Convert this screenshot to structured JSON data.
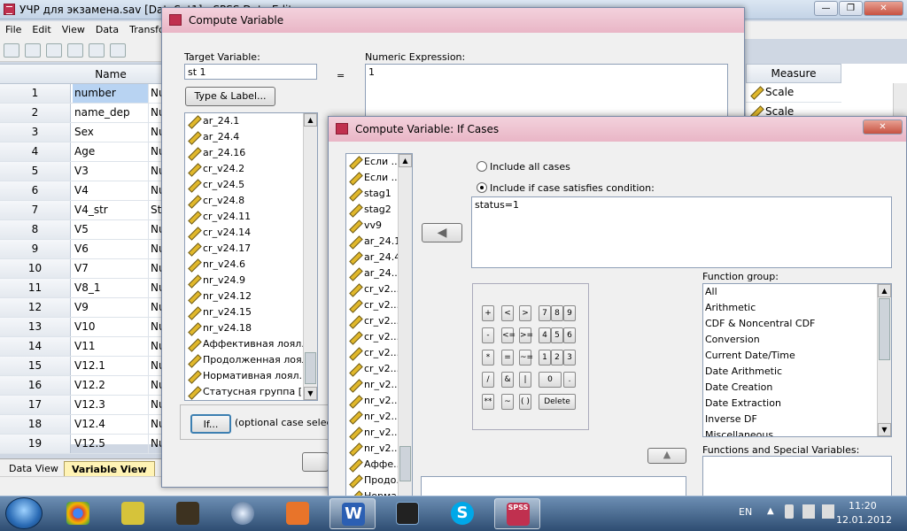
{
  "main_window": {
    "title": "УЧР для экзамена.sav [DataSet1] - SPSS Data Editor",
    "menu": [
      "File",
      "Edit",
      "View",
      "Data",
      "Transform"
    ],
    "grid": {
      "name_header": "Name",
      "rows": [
        {
          "n": "1",
          "name": "number",
          "type": "Nu"
        },
        {
          "n": "2",
          "name": "name_dep",
          "type": "Nu"
        },
        {
          "n": "3",
          "name": "Sex",
          "type": "Nu"
        },
        {
          "n": "4",
          "name": "Age",
          "type": "Nu"
        },
        {
          "n": "5",
          "name": "V3",
          "type": "Nu"
        },
        {
          "n": "6",
          "name": "V4",
          "type": "Nu"
        },
        {
          "n": "7",
          "name": "V4_str",
          "type": "St"
        },
        {
          "n": "8",
          "name": "V5",
          "type": "Nu"
        },
        {
          "n": "9",
          "name": "V6",
          "type": "Nu"
        },
        {
          "n": "10",
          "name": "V7",
          "type": "Nu"
        },
        {
          "n": "11",
          "name": "V8_1",
          "type": "Nu"
        },
        {
          "n": "12",
          "name": "V9",
          "type": "Nu"
        },
        {
          "n": "13",
          "name": "V10",
          "type": "Nu"
        },
        {
          "n": "14",
          "name": "V11",
          "type": "Nu"
        },
        {
          "n": "15",
          "name": "V12.1",
          "type": "Nu"
        },
        {
          "n": "16",
          "name": "V12.2",
          "type": "Nu"
        },
        {
          "n": "17",
          "name": "V12.3",
          "type": "Nu"
        },
        {
          "n": "18",
          "name": "V12.4",
          "type": "Nu"
        },
        {
          "n": "19",
          "name": "V12.5",
          "type": "Nu"
        }
      ]
    },
    "tabs": {
      "data_view": "Data View",
      "variable_view": "Variable View"
    },
    "measure": {
      "header": "Measure",
      "rows": [
        "Scale",
        "Scale"
      ]
    }
  },
  "compute_dialog": {
    "title": "Compute Variable",
    "target_label": "Target Variable:",
    "target_value": "st 1",
    "equals": "=",
    "expression_label": "Numeric Expression:",
    "expression_value": "1",
    "type_label_button": "Type & Label...",
    "variables": [
      "ar_24.1",
      "ar_24.4",
      "ar_24.16",
      "cr_v24.2",
      "cr_v24.5",
      "cr_v24.8",
      "cr_v24.11",
      "cr_v24.14",
      "cr_v24.17",
      "nr_v24.6",
      "nr_v24.9",
      "nr_v24.12",
      "nr_v24.15",
      "nr_v24.18",
      "Аффективная лоял...",
      "Продолженная лоял...",
      "Нормативная лоял...",
      "Статусная группа [..."
    ],
    "if_button": "If...",
    "if_note": "(optional case selection)"
  },
  "if_dialog": {
    "title": "Compute Variable: If Cases",
    "variables": [
      "Если ...",
      "Если ...",
      "stag1",
      "stag2",
      "vv9",
      "ar_24.1",
      "ar_24.4",
      "ar_24...",
      "cr_v2...",
      "cr_v2...",
      "cr_v2...",
      "cr_v2...",
      "cr_v2...",
      "cr_v2...",
      "nr_v2...",
      "nr_v2...",
      "nr_v2...",
      "nr_v2...",
      "nr_v2...",
      "Аффе...",
      "Продо...",
      "Норма..."
    ],
    "include_all": "Include all cases",
    "include_if": "Include if case satisfies condition:",
    "condition": "status=1",
    "keypad": {
      "row1": [
        "+",
        "<",
        ">",
        "7",
        "8",
        "9"
      ],
      "row2": [
        "-",
        "<=",
        ">=",
        "4",
        "5",
        "6"
      ],
      "row3": [
        "*",
        "=",
        "~=",
        "1",
        "2",
        "3"
      ],
      "row4": [
        "/",
        "&",
        "|",
        "0",
        "."
      ],
      "row5": [
        "**",
        "~",
        "( )",
        "Delete"
      ]
    },
    "function_group_label": "Function group:",
    "function_groups": [
      "All",
      "Arithmetic",
      "CDF & Noncentral CDF",
      "Conversion",
      "Current Date/Time",
      "Date Arithmetic",
      "Date Creation",
      "Date Extraction",
      "Inverse DF",
      "Miscellaneous"
    ],
    "functions_label": "Functions and Special Variables:"
  },
  "taskbar": {
    "lang": "EN",
    "time": "11:20",
    "date": "12.01.2012"
  }
}
